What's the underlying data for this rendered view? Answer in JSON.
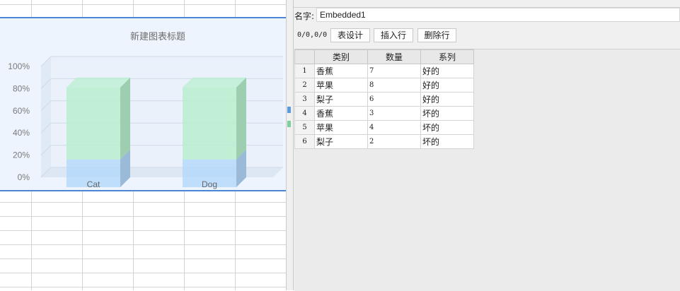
{
  "panel": {
    "name_label": "名字:",
    "name_value": "Embedded1",
    "cell_position": "0/0,0/0",
    "buttons": {
      "table_design": "表设计",
      "insert_row": "插入行",
      "delete_row": "删除行"
    }
  },
  "table": {
    "headers": [
      "类别",
      "数量",
      "系列"
    ],
    "rows": [
      {
        "num": "1",
        "category": "香蕉",
        "quantity": "7",
        "series": "好的"
      },
      {
        "num": "2",
        "category": "苹果",
        "quantity": "8",
        "series": "好的"
      },
      {
        "num": "3",
        "category": "梨子",
        "quantity": "6",
        "series": "好的"
      },
      {
        "num": "4",
        "category": "香蕉",
        "quantity": "3",
        "series": "坏的"
      },
      {
        "num": "5",
        "category": "苹果",
        "quantity": "4",
        "series": "坏的"
      },
      {
        "num": "6",
        "category": "梨子",
        "quantity": "2",
        "series": "坏的"
      }
    ]
  },
  "colors": {
    "selection_border": "#4a86d4",
    "series_top": "#b6efcd",
    "series_bottom": "#b3d8fb"
  },
  "chart_data": {
    "type": "bar",
    "stacked": "percent",
    "3d": true,
    "title": "新建图表标题",
    "categories": [
      "Cat",
      "Dog"
    ],
    "yticks": [
      "0%",
      "20%",
      "40%",
      "60%",
      "80%",
      "100%"
    ],
    "ylim": [
      0,
      100
    ],
    "grid": true,
    "series": [
      {
        "values": [
          25,
          25
        ],
        "color": "#b3d8fb"
      },
      {
        "values": [
          65,
          65
        ],
        "color": "#b6efcd"
      }
    ]
  }
}
